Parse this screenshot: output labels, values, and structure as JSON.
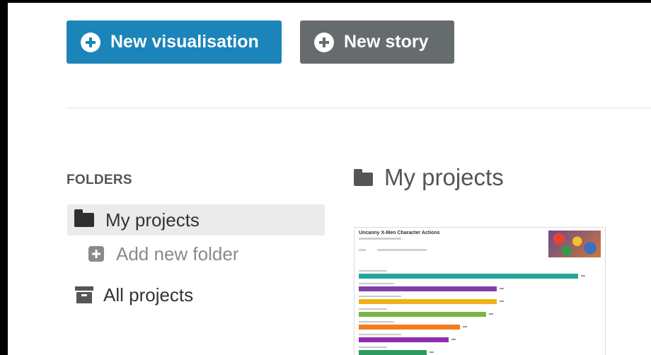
{
  "toolbar": {
    "new_visualisation_label": "New visualisation",
    "new_story_label": "New story",
    "primary_color": "#1b84b9",
    "secondary_color": "#666b6e"
  },
  "sidebar": {
    "heading": "FOLDERS",
    "items": [
      {
        "label": "My projects",
        "icon": "folder-icon",
        "active": true
      },
      {
        "label": "Add new folder",
        "icon": "plus-square-icon",
        "active": false
      },
      {
        "label": "All projects",
        "icon": "archive-icon",
        "active": false
      }
    ]
  },
  "main": {
    "section_title": "My projects",
    "section_icon": "folder-icon",
    "projects": [
      {
        "thumbnail": {
          "title": "Uncanny X-Men Character Actions",
          "bars": [
            {
              "color": "#26a69a",
              "value": 1.0
            },
            {
              "color": "#7e3fa6",
              "value": 0.63
            },
            {
              "color": "#f0b21b",
              "value": 0.63
            },
            {
              "color": "#7cb342",
              "value": 0.58
            },
            {
              "color": "#f57c1f",
              "value": 0.46
            },
            {
              "color": "#8e2db0",
              "value": 0.41
            },
            {
              "color": "#2e9a63",
              "value": 0.31
            }
          ]
        }
      }
    ]
  }
}
